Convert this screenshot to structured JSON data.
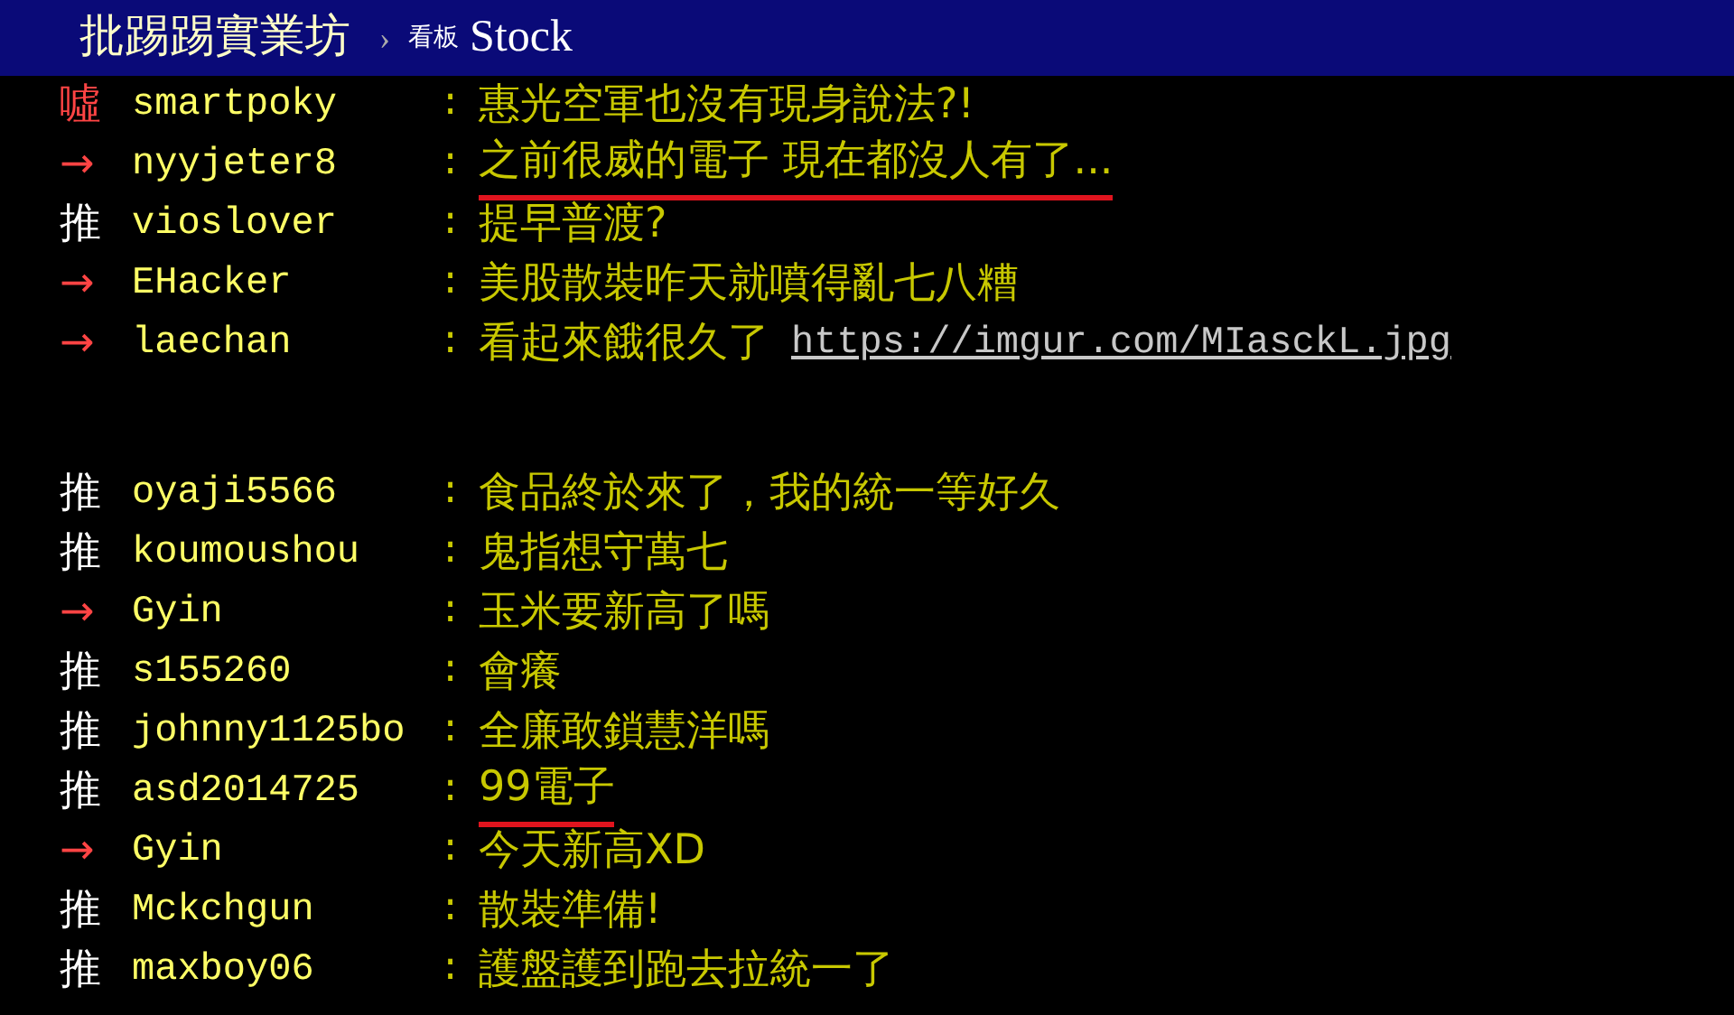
{
  "header": {
    "site": "批踢踢實業坊",
    "separator": "›",
    "board_label": "看板",
    "board": "Stock"
  },
  "comment_groups": [
    {
      "comments": [
        {
          "tag": "噓",
          "kind": "boo",
          "user": "smartpoky",
          "separator": ":",
          "text": "惠光空軍也沒有現身說法?!",
          "highlighted": false
        },
        {
          "tag": "→",
          "kind": "arrow",
          "user": "nyyjeter8",
          "separator": ":",
          "text": "之前很威的電子 現在都沒人有了...",
          "highlighted": true
        },
        {
          "tag": "推",
          "kind": "push",
          "user": "vioslover",
          "separator": ":",
          "text": "提早普渡?",
          "highlighted": false
        },
        {
          "tag": "→",
          "kind": "arrow",
          "user": "EHacker",
          "separator": ":",
          "text": "美股散裝昨天就噴得亂七八糟",
          "highlighted": false
        },
        {
          "tag": "→",
          "kind": "arrow",
          "user": "laechan",
          "separator": ":",
          "text": "看起來餓很久了",
          "link": "https://imgur.com/MIasckL.jpg",
          "highlighted": false
        }
      ]
    },
    {
      "comments": [
        {
          "tag": "推",
          "kind": "push",
          "user": "oyaji5566",
          "separator": ":",
          "text": "食品終於來了，我的統一等好久",
          "highlighted": false
        },
        {
          "tag": "推",
          "kind": "push",
          "user": "koumoushou",
          "separator": ":",
          "text": "鬼指想守萬七",
          "highlighted": false
        },
        {
          "tag": "→",
          "kind": "arrow",
          "user": "Gyin",
          "separator": ":",
          "text": "玉米要新高了嗎",
          "highlighted": false
        },
        {
          "tag": "推",
          "kind": "push",
          "user": "s155260",
          "separator": ":",
          "text": "會癢",
          "highlighted": false
        },
        {
          "tag": "推",
          "kind": "push",
          "user": "johnny1125bo",
          "separator": ":",
          "text": "全廉敢鎖慧洋嗎",
          "highlighted": false
        },
        {
          "tag": "推",
          "kind": "push",
          "user": "asd2014725",
          "separator": ":",
          "text": "99電子",
          "highlighted": true
        },
        {
          "tag": "→",
          "kind": "arrow",
          "user": "Gyin",
          "separator": ":",
          "text": "今天新高XD",
          "highlighted": false
        },
        {
          "tag": "推",
          "kind": "push",
          "user": "Mckchgun",
          "separator": ":",
          "text": "散裝準備!",
          "highlighted": false
        },
        {
          "tag": "推",
          "kind": "push",
          "user": "maxboy06",
          "separator": ":",
          "text": "護盤護到跑去拉統一了",
          "highlighted": false
        }
      ]
    }
  ]
}
